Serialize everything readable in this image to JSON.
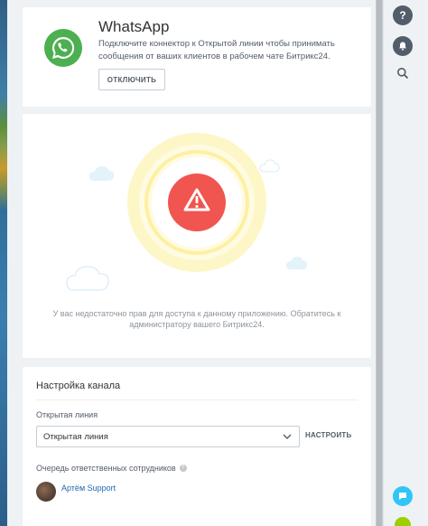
{
  "header": {
    "title": "WhatsApp",
    "description": "Подключите коннектор к Открытой линии чтобы принимать сообщения от ваших клиентов в рабочем чате Битрикс24.",
    "disable_button": "ОТКЛЮЧИТЬ"
  },
  "error": {
    "message": "У вас недостаточно прав для доступа к данному приложению. Обратитесь к администратору вашего Битрикс24."
  },
  "settings": {
    "title": "Настройка канала",
    "open_line_label": "Открытая линия",
    "open_line_value": "Открытая линия",
    "configure_button": "НАСТРОИТЬ",
    "queue_label": "Очередь ответственных сотрудников",
    "queue_users": [
      {
        "name": "Артём Support"
      }
    ]
  },
  "right_panel": {
    "help_glyph": "?",
    "icons": [
      "help-icon",
      "bell-icon",
      "search-icon",
      "open-lines-icon"
    ]
  },
  "colors": {
    "whatsapp_green": "#4caf50",
    "error_red": "#f0554f",
    "ring_yellow": "#fdf4b0",
    "link_blue": "#2067b0",
    "accent_cyan": "#2fc6f6"
  }
}
